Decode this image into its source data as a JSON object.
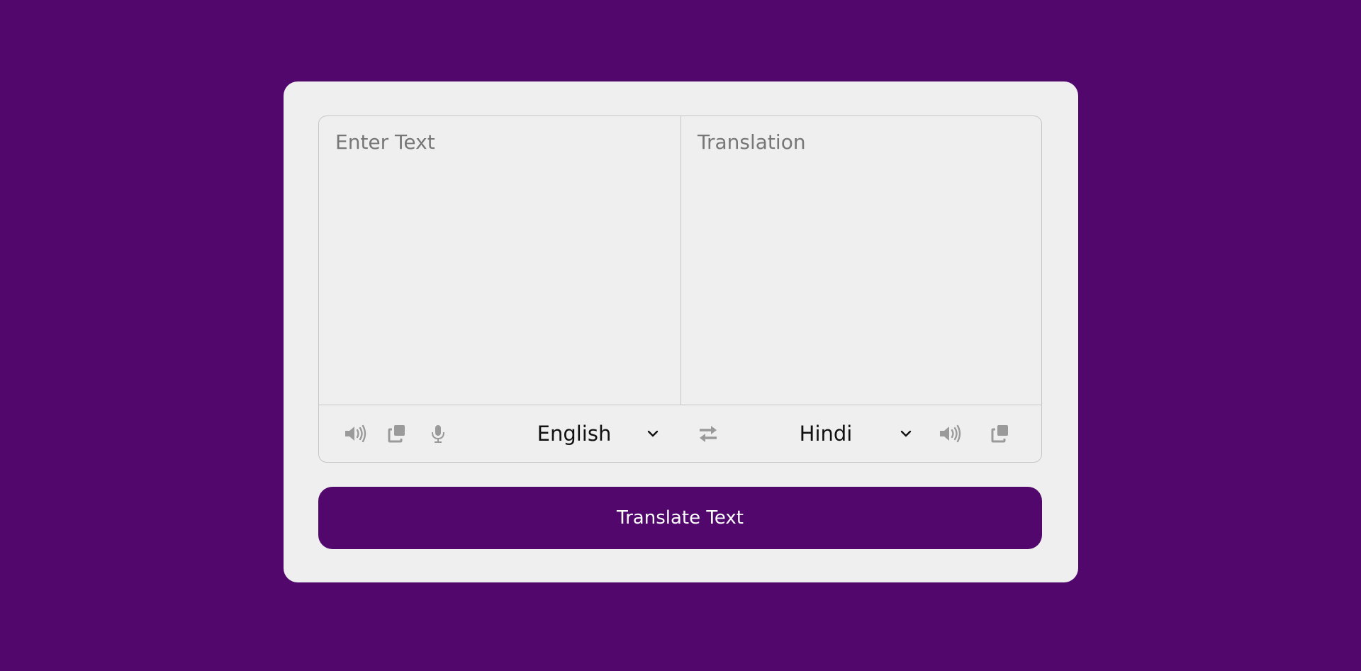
{
  "source": {
    "placeholder": "Enter Text",
    "language": "English"
  },
  "target": {
    "placeholder": "Translation",
    "language": "Hindi"
  },
  "actions": {
    "translate_label": "Translate Text"
  },
  "icons": {
    "source_speak": "volume-icon",
    "source_copy": "copy-icon",
    "source_mic": "microphone-icon",
    "swap": "swap-icon",
    "target_speak": "volume-icon",
    "target_copy": "copy-icon",
    "dropdown": "chevron-down-icon"
  },
  "colors": {
    "background": "#52076d",
    "card": "#efefef",
    "accent": "#52076d",
    "icon": "#9a9a9a"
  }
}
